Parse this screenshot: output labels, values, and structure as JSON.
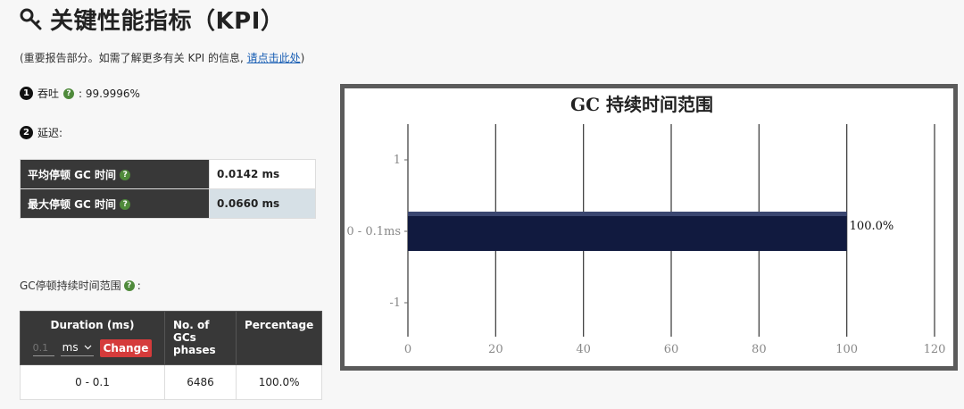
{
  "header": {
    "title": "关键性能指标（KPI）",
    "icon": "key-icon"
  },
  "intro": {
    "prefix": "(重要报告部分。如需了解更多有关 KPI 的信息, ",
    "link": "请点击此处",
    "suffix": ")"
  },
  "throughput": {
    "badge": "1",
    "label": "吞吐",
    "value": ": 99.9996%"
  },
  "latency": {
    "badge": "2",
    "label": "延迟:",
    "rows": [
      {
        "label": "平均停顿 GC 时间",
        "value": "0.0142 ms"
      },
      {
        "label": "最大停顿 GC 时间",
        "value": "0.0660 ms"
      }
    ]
  },
  "range_section": {
    "label": "GC停顿持续时间范围",
    "suffix": ":"
  },
  "duration_table": {
    "headers": {
      "duration": "Duration (ms)",
      "count": "No. of GCs phases",
      "percentage": "Percentage"
    },
    "input_placeholder": "0.1",
    "unit_selected": "ms",
    "change_label": "Change",
    "rows": [
      {
        "range": "0 - 0.1",
        "count": "6486",
        "percentage": "100.0%"
      }
    ]
  },
  "chart_data": {
    "type": "bar",
    "orientation": "horizontal",
    "title": "GC 持续时间范围",
    "categories": [
      "0 - 0.1ms"
    ],
    "values": [
      100.0
    ],
    "data_labels": [
      "100.0%"
    ],
    "xlim": [
      0,
      120
    ],
    "x_ticks": [
      "0",
      "20",
      "40",
      "60",
      "80",
      "100",
      "120"
    ],
    "y_ticks": [
      "1",
      "0 - 0.1ms",
      "-1"
    ],
    "grid": true,
    "bar_color": "#111a3f"
  },
  "colors": {
    "header_bg": "#383838",
    "accent_red": "#d53b3b",
    "help_green": "#4f8a3b",
    "link": "#1a5fb4"
  }
}
